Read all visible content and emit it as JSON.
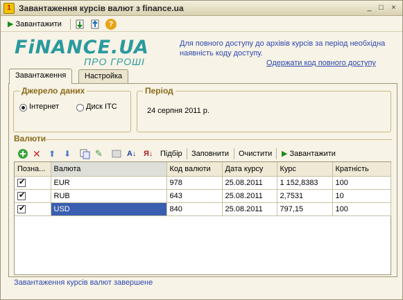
{
  "window": {
    "title": "Завантаження курсів валют з finance.ua",
    "controls": [
      "_",
      "□",
      "×"
    ]
  },
  "toolbar": {
    "download_label": "Завантажити",
    "icons": [
      "import-icon",
      "export-icon",
      "help-icon"
    ]
  },
  "logo": {
    "main": "FiNANCE.UA",
    "sub": "ПРО ГРОШІ"
  },
  "info": {
    "text": "Для повного доступу до архівів курсів за період необхідна наявність коду доступу.",
    "link": "Одержати код повного доступу"
  },
  "tabs": [
    {
      "label": "Завантаження",
      "active": true
    },
    {
      "label": "Настройка",
      "active": false
    }
  ],
  "source": {
    "title": "Джерело даних",
    "options": [
      {
        "label": "Інтернет",
        "checked": true
      },
      {
        "label": "Диск ITC",
        "checked": false
      }
    ]
  },
  "period": {
    "title": "Період",
    "value": "24 серпня 2011 р."
  },
  "currencies": {
    "title": "Валюти",
    "actions": {
      "select": "Підбір",
      "fill": "Заповнити",
      "clear": "Очистити",
      "download": "Завантажити"
    },
    "columns": [
      "Позна...",
      "Валюта",
      "Код валюти",
      "Дата курсу",
      "Курс",
      "Кратність"
    ],
    "rows": [
      {
        "mark": true,
        "currency": "EUR",
        "code": "978",
        "date": "25.08.2011",
        "rate": "1 152,8383",
        "multiplicity": "100"
      },
      {
        "mark": true,
        "currency": "RUB",
        "code": "643",
        "date": "25.08.2011",
        "rate": "2,7531",
        "multiplicity": "10"
      },
      {
        "mark": true,
        "currency": "USD",
        "code": "840",
        "date": "25.08.2011",
        "rate": "797,15",
        "multiplicity": "100"
      }
    ]
  },
  "status": "Завантаження курсів валют завершене"
}
